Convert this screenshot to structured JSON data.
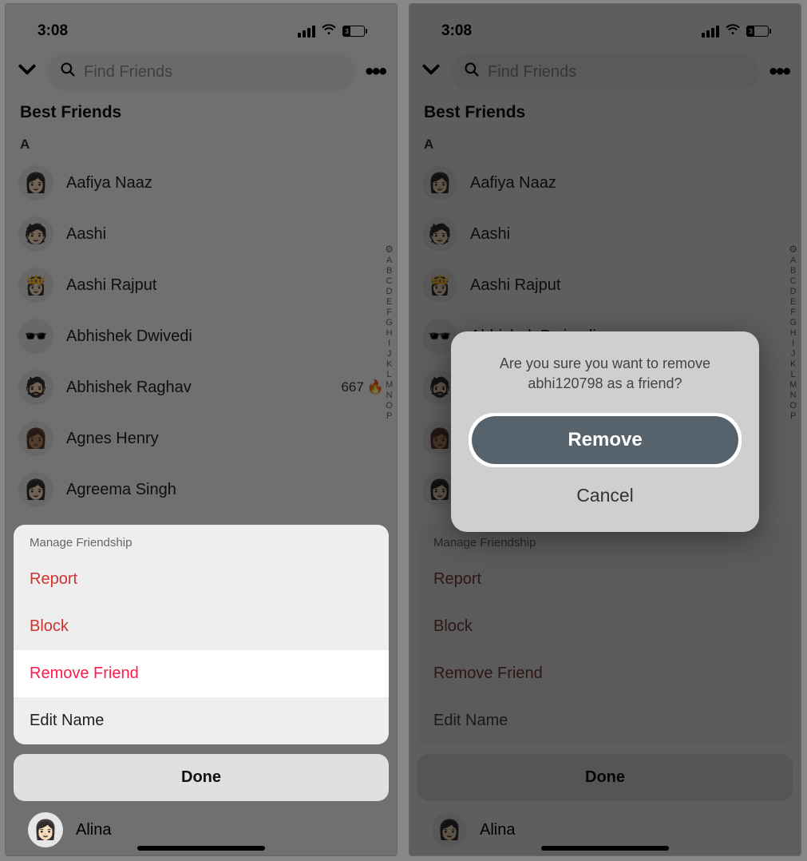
{
  "status": {
    "time": "3:08",
    "battery_pct": "3"
  },
  "search": {
    "placeholder": "Find Friends"
  },
  "section_label": "Best Friends",
  "group_letter": "A",
  "friends": [
    {
      "name": "Aafiya Naaz",
      "emoji": "👩🏻"
    },
    {
      "name": "Aashi",
      "emoji": "🧑🏻"
    },
    {
      "name": "Aashi Rajput",
      "emoji": "👸🏻"
    },
    {
      "name": "Abhishek Dwivedi",
      "emoji": "🕶️"
    },
    {
      "name": "Abhishek Raghav",
      "emoji": "🧔🏻",
      "streak": "667",
      "streak_icon": "🔥"
    },
    {
      "name": "Agnes Henry",
      "emoji": "👩🏽"
    },
    {
      "name": "Agreema Singh",
      "emoji": "👩🏻"
    }
  ],
  "bottom_peek_name": "Alina",
  "index_letters": [
    "A",
    "B",
    "C",
    "D",
    "E",
    "F",
    "G",
    "H",
    "I",
    "J",
    "K",
    "L",
    "M",
    "N",
    "O",
    "P"
  ],
  "sheet": {
    "title": "Manage Friendship",
    "report": "Report",
    "block": "Block",
    "remove_friend": "Remove Friend",
    "edit_name": "Edit Name",
    "done": "Done"
  },
  "confirm": {
    "message_line1": "Are you sure you want to remove",
    "message_line2": "abhi120798 as a friend?",
    "remove": "Remove",
    "cancel": "Cancel"
  }
}
